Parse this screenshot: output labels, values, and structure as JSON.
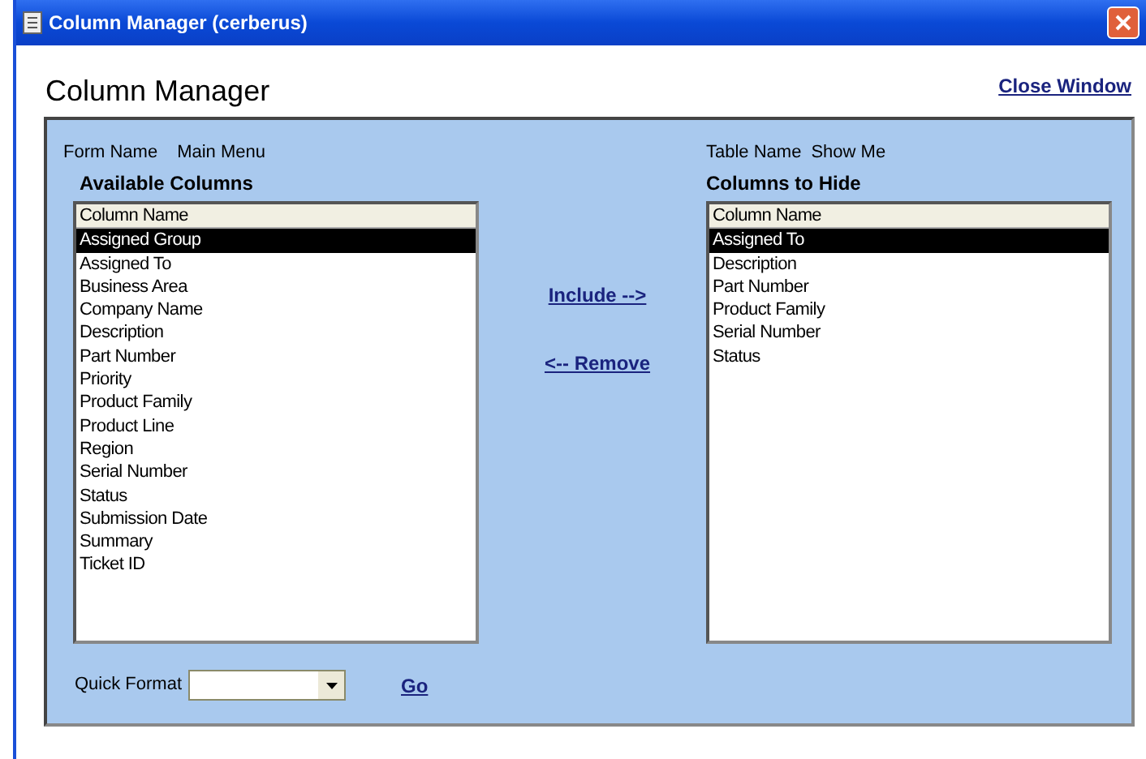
{
  "window": {
    "title": "Column Manager (cerberus)"
  },
  "page_title": "Column Manager",
  "close_link": "Close Window",
  "form": {
    "label": "Form Name",
    "value": "Main Menu"
  },
  "table": {
    "label": "Table Name",
    "value": "Show Me"
  },
  "available": {
    "heading": "Available Columns",
    "header": "Column Name",
    "items": [
      {
        "label": "Assigned Group",
        "selected": true
      },
      {
        "label": "Assigned To",
        "selected": false
      },
      {
        "label": "Business Area",
        "selected": false
      },
      {
        "label": "Company Name",
        "selected": false
      },
      {
        "label": "Description",
        "selected": false
      },
      {
        "label": "Part Number",
        "selected": false
      },
      {
        "label": "Priority",
        "selected": false
      },
      {
        "label": "Product Family",
        "selected": false
      },
      {
        "label": "Product Line",
        "selected": false
      },
      {
        "label": "Region",
        "selected": false
      },
      {
        "label": "Serial Number",
        "selected": false
      },
      {
        "label": "Status",
        "selected": false
      },
      {
        "label": "Submission Date",
        "selected": false
      },
      {
        "label": "Summary",
        "selected": false
      },
      {
        "label": "Ticket ID",
        "selected": false
      }
    ]
  },
  "hidden": {
    "heading": "Columns to Hide",
    "header": "Column Name",
    "items": [
      {
        "label": "Assigned To",
        "selected": true
      },
      {
        "label": "Description",
        "selected": false
      },
      {
        "label": "Part Number",
        "selected": false
      },
      {
        "label": "Product Family",
        "selected": false
      },
      {
        "label": "Serial Number",
        "selected": false
      },
      {
        "label": "Status",
        "selected": false
      }
    ]
  },
  "include_link": "Include -->",
  "remove_link": "<-- Remove",
  "quick_format": {
    "label": "Quick Format"
  },
  "go_link": "Go"
}
